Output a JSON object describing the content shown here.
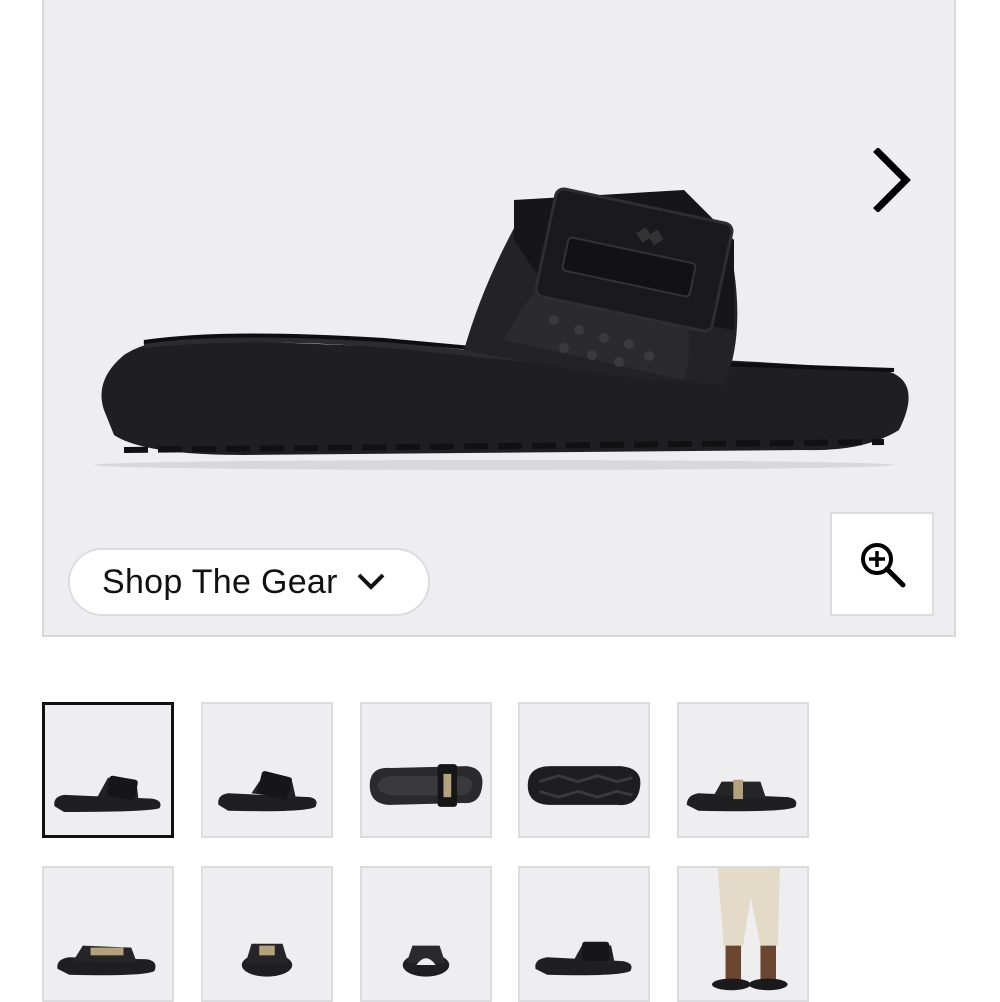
{
  "hero": {
    "image_name": "black-slide-sandal-side-view",
    "next_icon": "chevron-right-icon",
    "zoom_icon": "zoom-in-icon"
  },
  "shop_button": {
    "label": "Shop The Gear",
    "icon": "chevron-down-icon"
  },
  "thumbnails": [
    {
      "view": "side",
      "active": true
    },
    {
      "view": "angled-side",
      "active": false
    },
    {
      "view": "top",
      "active": false
    },
    {
      "view": "sole",
      "active": false
    },
    {
      "view": "back-angle",
      "active": false
    },
    {
      "view": "front-angle",
      "active": false
    },
    {
      "view": "front",
      "active": false
    },
    {
      "view": "heel",
      "active": false
    },
    {
      "view": "rear-angle",
      "active": false
    },
    {
      "view": "on-model",
      "active": false
    }
  ],
  "colors": {
    "image_background": "#eeeef0",
    "border": "#dcdcde",
    "active_border": "#111111",
    "product": "#1c1c1e"
  }
}
